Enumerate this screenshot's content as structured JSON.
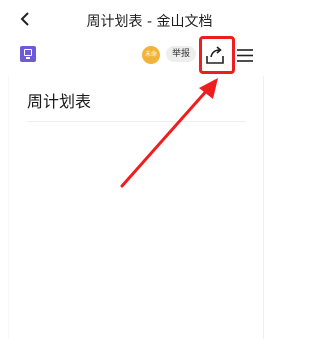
{
  "header": {
    "back_icon": "chevron-left-icon",
    "title": "周计划表 - 金山文档"
  },
  "toolbar": {
    "doc_icon": "document-icon",
    "avatar_text": "未命",
    "report_label": "举报",
    "share_icon": "share-icon",
    "menu_icon": "menu-icon"
  },
  "document": {
    "heading": "周计划表"
  },
  "colors": {
    "highlight": "#ee1e1e",
    "doc_icon": "#6f5bd6",
    "avatar": "#f3b33b"
  }
}
